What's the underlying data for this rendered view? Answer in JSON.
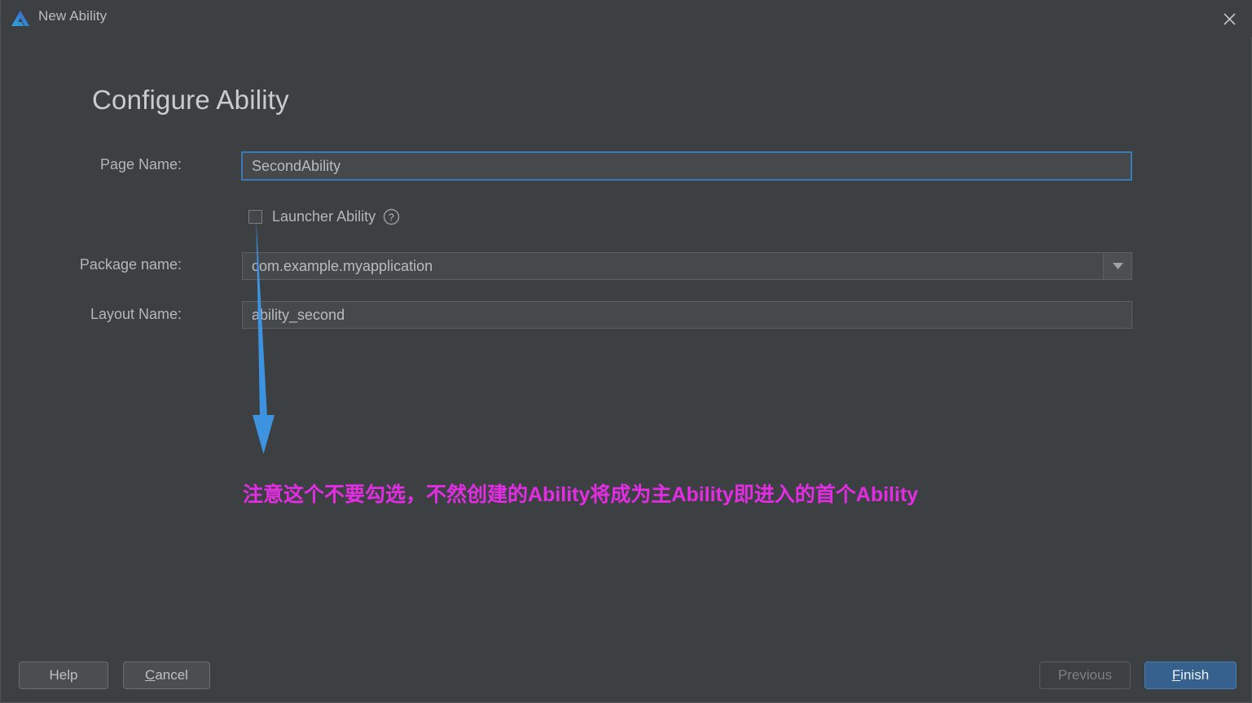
{
  "window": {
    "title": "New Ability",
    "logo_icon": "deveco-triangle-logo",
    "close_icon": "close-icon"
  },
  "heading": "Configure Ability",
  "form": {
    "page_name": {
      "label": "Page Name:",
      "value": "SecondAbility"
    },
    "launcher": {
      "label": "Launcher Ability",
      "checked": false,
      "help_icon": "question-mark-circle-icon"
    },
    "package_name": {
      "label": "Package name:",
      "value": "com.example.myapplication",
      "dropdown_icon": "chevron-down-icon"
    },
    "layout_name": {
      "label": "Layout Name:",
      "value": "ability_second"
    }
  },
  "annotation": {
    "arrow_icon": "down-arrow-annotation",
    "arrow_color": "#3d93e0",
    "text": "注意这个不要勾选，不然创建的Ability将成为主Ability即进入的首个Ability",
    "text_color": "#e32de3"
  },
  "footer": {
    "help": "Help",
    "cancel": "Cancel",
    "cancel_mnemonic": "C",
    "cancel_rest": "ancel",
    "previous": "Previous",
    "finish": "Finish",
    "finish_mnemonic": "F",
    "finish_rest": "inish"
  },
  "colors": {
    "background": "#3c4043",
    "field_background": "#45494b",
    "focus_border": "#3c7ab3",
    "primary_button": "#36618f",
    "accent_blue": "#3d93e0",
    "annotation_magenta": "#e32de3"
  }
}
